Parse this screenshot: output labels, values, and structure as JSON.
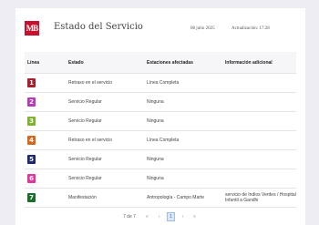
{
  "header": {
    "logo_text": "MB",
    "title": "Estado del Servicio",
    "date": "08 julio 2025",
    "update": "Actualización: 17:28"
  },
  "table": {
    "columns": [
      "Línea",
      "Estado",
      "Estaciones afectadas",
      "Información adicional"
    ],
    "rows": [
      {
        "line": "1",
        "color": "#a81e2d",
        "status": "Retraso en el servicio",
        "stations": "Línea Completa",
        "info": ""
      },
      {
        "line": "2",
        "color": "#b43bb8",
        "status": "Servicio Regular",
        "stations": "Ninguna",
        "info": ""
      },
      {
        "line": "3",
        "color": "#7fb32e",
        "status": "Servicio Regular",
        "stations": "Ninguna",
        "info": ""
      },
      {
        "line": "4",
        "color": "#d2691e",
        "status": "Retraso en el servicio",
        "stations": "Línea Completa",
        "info": ""
      },
      {
        "line": "5",
        "color": "#1f2a6e",
        "status": "Servicio Regular",
        "stations": "Ninguna",
        "info": ""
      },
      {
        "line": "6",
        "color": "#e0389a",
        "status": "Servicio Regular",
        "stations": "Ninguna",
        "info": ""
      },
      {
        "line": "7",
        "color": "#1b6e2a",
        "status": "Manifestación",
        "stations": "Antropología - Campo Marte",
        "info": "servicio de Indios Verdes / Hospital Infantil a Gandhi"
      }
    ]
  },
  "pagination": {
    "info": "7 de 7",
    "first": "«",
    "prev": "‹",
    "current": "1",
    "next": "›",
    "last": "»"
  }
}
